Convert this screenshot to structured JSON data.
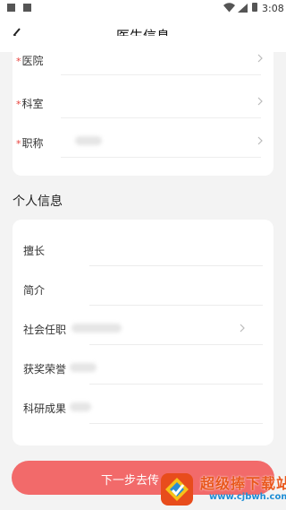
{
  "status_bar": {
    "time": "3:08"
  },
  "header": {
    "title": "医生信息"
  },
  "card_basic": {
    "required_mark": "*",
    "rows": [
      {
        "label": "医院"
      },
      {
        "label": "科室"
      },
      {
        "label": "职称"
      }
    ]
  },
  "section_personal": {
    "title": "个人信息",
    "rows": [
      {
        "label": "擅长"
      },
      {
        "label": "简介"
      },
      {
        "label": "社会任职"
      },
      {
        "label": "获奖荣誉"
      },
      {
        "label": "科研成果"
      }
    ]
  },
  "footer": {
    "button_label": "下一步去传"
  },
  "watermark": {
    "title": "超级捧下载站",
    "url": "www.cjbwh.com"
  },
  "colors": {
    "accent": "#f26a6a",
    "required": "#e8433d",
    "background": "#f3f3f3"
  }
}
